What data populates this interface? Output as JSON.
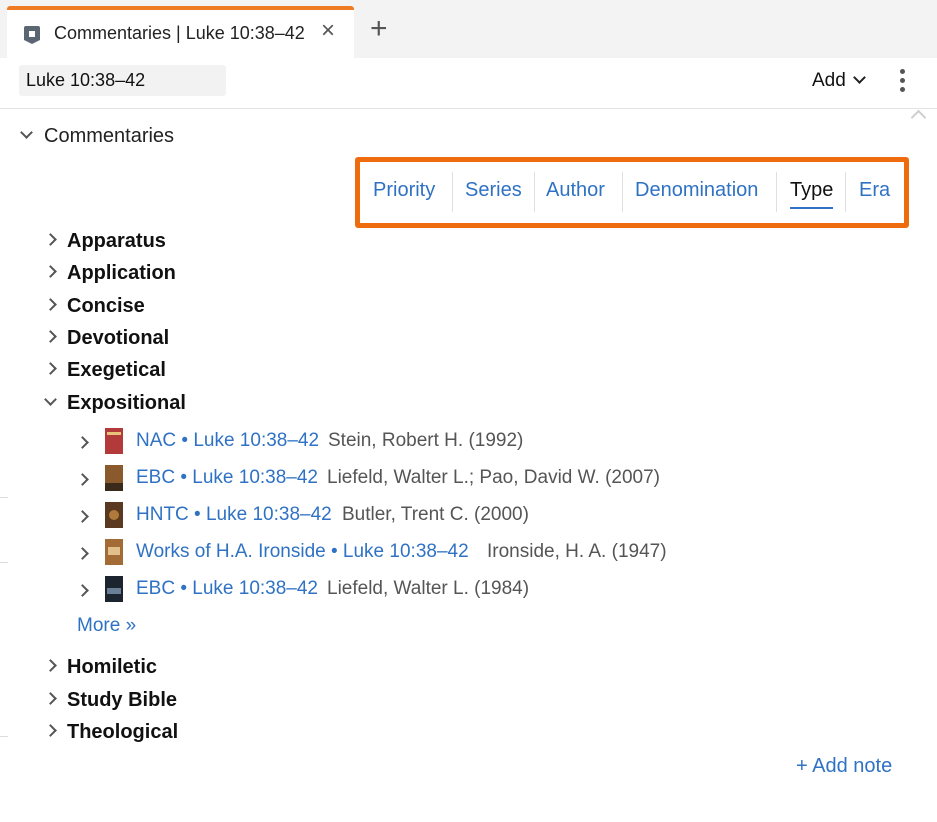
{
  "tab": {
    "title": "Commentaries | Luke 10:38–42",
    "close_icon": "×",
    "new_tab_icon": "+"
  },
  "toolbar": {
    "reference": "Luke 10:38–42",
    "add_label": "Add"
  },
  "section": {
    "title": "Commentaries"
  },
  "sort_options": [
    "Priority",
    "Series",
    "Author",
    "Denomination",
    "Type",
    "Era"
  ],
  "sort_active": "Type",
  "categories_before": [
    "Apparatus",
    "Application",
    "Concise",
    "Devotional",
    "Exegetical"
  ],
  "expanded_category": "Expositional",
  "entries": [
    {
      "link": "NAC • Luke 10:38–42",
      "meta": "Stein, Robert H. (1992)",
      "cover_color": "#b23a3a"
    },
    {
      "link": "EBC • Luke 10:38–42",
      "meta": "Liefeld, Walter L.; Pao, David W. (2007)",
      "cover_color": "#8a5a2c"
    },
    {
      "link": "HNTC • Luke 10:38–42",
      "meta": "Butler, Trent C. (2000)",
      "cover_color": "#5b3820"
    },
    {
      "link": "Works of H.A. Ironside • Luke 10:38–42",
      "meta": "Ironside, H. A. (1947)",
      "cover_color": "#a36b36"
    },
    {
      "link": "EBC • Luke 10:38–42",
      "meta": "Liefeld, Walter L. (1984)",
      "cover_color": "#1c2430"
    }
  ],
  "more_label": "More »",
  "categories_after": [
    "Homiletic",
    "Study Bible",
    "Theological"
  ],
  "add_note_label": "+ Add note",
  "colors": {
    "accent": "#ef6c0e",
    "link": "#2f72c4",
    "tab_accent": "#ee7b22"
  }
}
